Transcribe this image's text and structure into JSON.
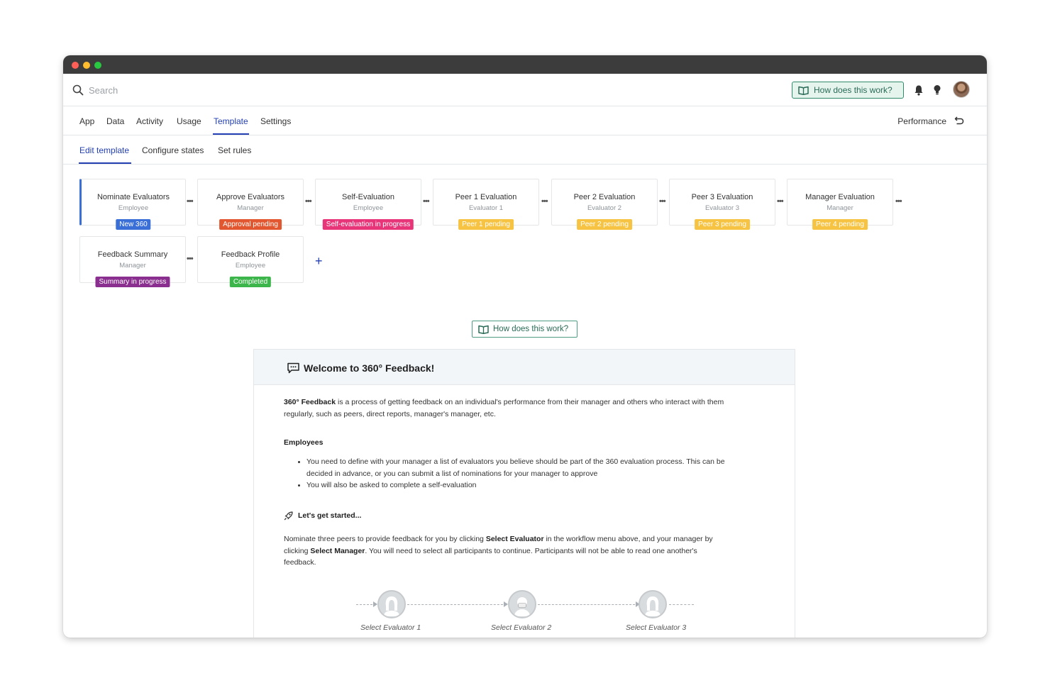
{
  "search": {
    "placeholder": "Search"
  },
  "header": {
    "help_label": "How does this work?"
  },
  "nav": {
    "tabs": [
      "App",
      "Data",
      "Activity",
      "Usage",
      "Template",
      "Settings"
    ],
    "active": "Template",
    "performance_label": "Performance"
  },
  "subnav": {
    "tabs": [
      "Edit template",
      "Configure states",
      "Set rules"
    ],
    "active": "Edit template"
  },
  "workflow": {
    "steps": [
      {
        "title": "Nominate Evaluators",
        "role": "Employee",
        "badge": "New 360",
        "badge_color": "#3a6fd8"
      },
      {
        "title": "Approve Evaluators",
        "role": "Manager",
        "badge": "Approval pending",
        "badge_color": "#e2572f"
      },
      {
        "title": "Self-Evaluation",
        "role": "Employee",
        "badge": "Self-evaluation in progress",
        "badge_color": "#e8357a"
      },
      {
        "title": "Peer 1 Evaluation",
        "role": "Evaluator 1",
        "badge": "Peer 1 pending",
        "badge_color": "#f6c342"
      },
      {
        "title": "Peer 2 Evaluation",
        "role": "Evaluator 2",
        "badge": "Peer 2 pending",
        "badge_color": "#f6c342"
      },
      {
        "title": "Peer 3 Evaluation",
        "role": "Evaluator 3",
        "badge": "Peer 3 pending",
        "badge_color": "#f6c342"
      },
      {
        "title": "Manager Evaluation",
        "role": "Manager",
        "badge": "Peer 4 pending",
        "badge_color": "#f6c342"
      },
      {
        "title": "Feedback Summary",
        "role": "Manager",
        "badge": "Summary in progress",
        "badge_color": "#8a2f8f"
      },
      {
        "title": "Feedback Profile",
        "role": "Employee",
        "badge": "Completed",
        "badge_color": "#3cb54a"
      }
    ],
    "more_glyph": "•••",
    "add_glyph": "+"
  },
  "help2": {
    "label": "How does this work?"
  },
  "welcome": {
    "title": "Welcome to 360° Feedback!",
    "intro_bold": "360° Feedback",
    "intro_rest_1": " is a process of getting feedback on an individual's performance from their manager and others who interact with them",
    "intro_rest_2": "regularly, such as peers, direct reports, manager's manager, etc.",
    "employees_heading": "Employees",
    "bullet1_line1": "You need to define with your manager a list of evaluators you believe should be part of the 360 evaluation process. This can be",
    "bullet1_line2": "decided in advance, or you can submit a list of nominations for your manager to approve",
    "bullet2": "You will also be asked to complete a self-evaluation",
    "started_heading": "Let's get started...",
    "nom_a": "Nominate three peers to provide feedback for you by clicking ",
    "nom_b_bold": "Select Evaluator",
    "nom_c": " in the workflow menu above, and your manager by",
    "nom_d": "clicking ",
    "nom_e_bold": "Select Manager",
    "nom_f": ". You will need to select all participants to continue. Participants will not be able to read one another's",
    "nom_g": "feedback.",
    "evaluators": [
      "Select Evaluator 1",
      "Select Evaluator 2",
      "Select Evaluator 3"
    ]
  },
  "colors": {
    "accent": "#2440b3",
    "help_green": "#2f8a6a",
    "titlebar": "#3c3c3c",
    "traffic_red": "#ff5f57",
    "traffic_yellow": "#febc2e",
    "traffic_green": "#28c840"
  },
  "icons": [
    "search-icon",
    "book-icon",
    "bell-icon",
    "lightbulb-icon",
    "avatar",
    "undo-arrow-icon",
    "chat-bubble-icon",
    "rocket-icon",
    "person-icon"
  ]
}
